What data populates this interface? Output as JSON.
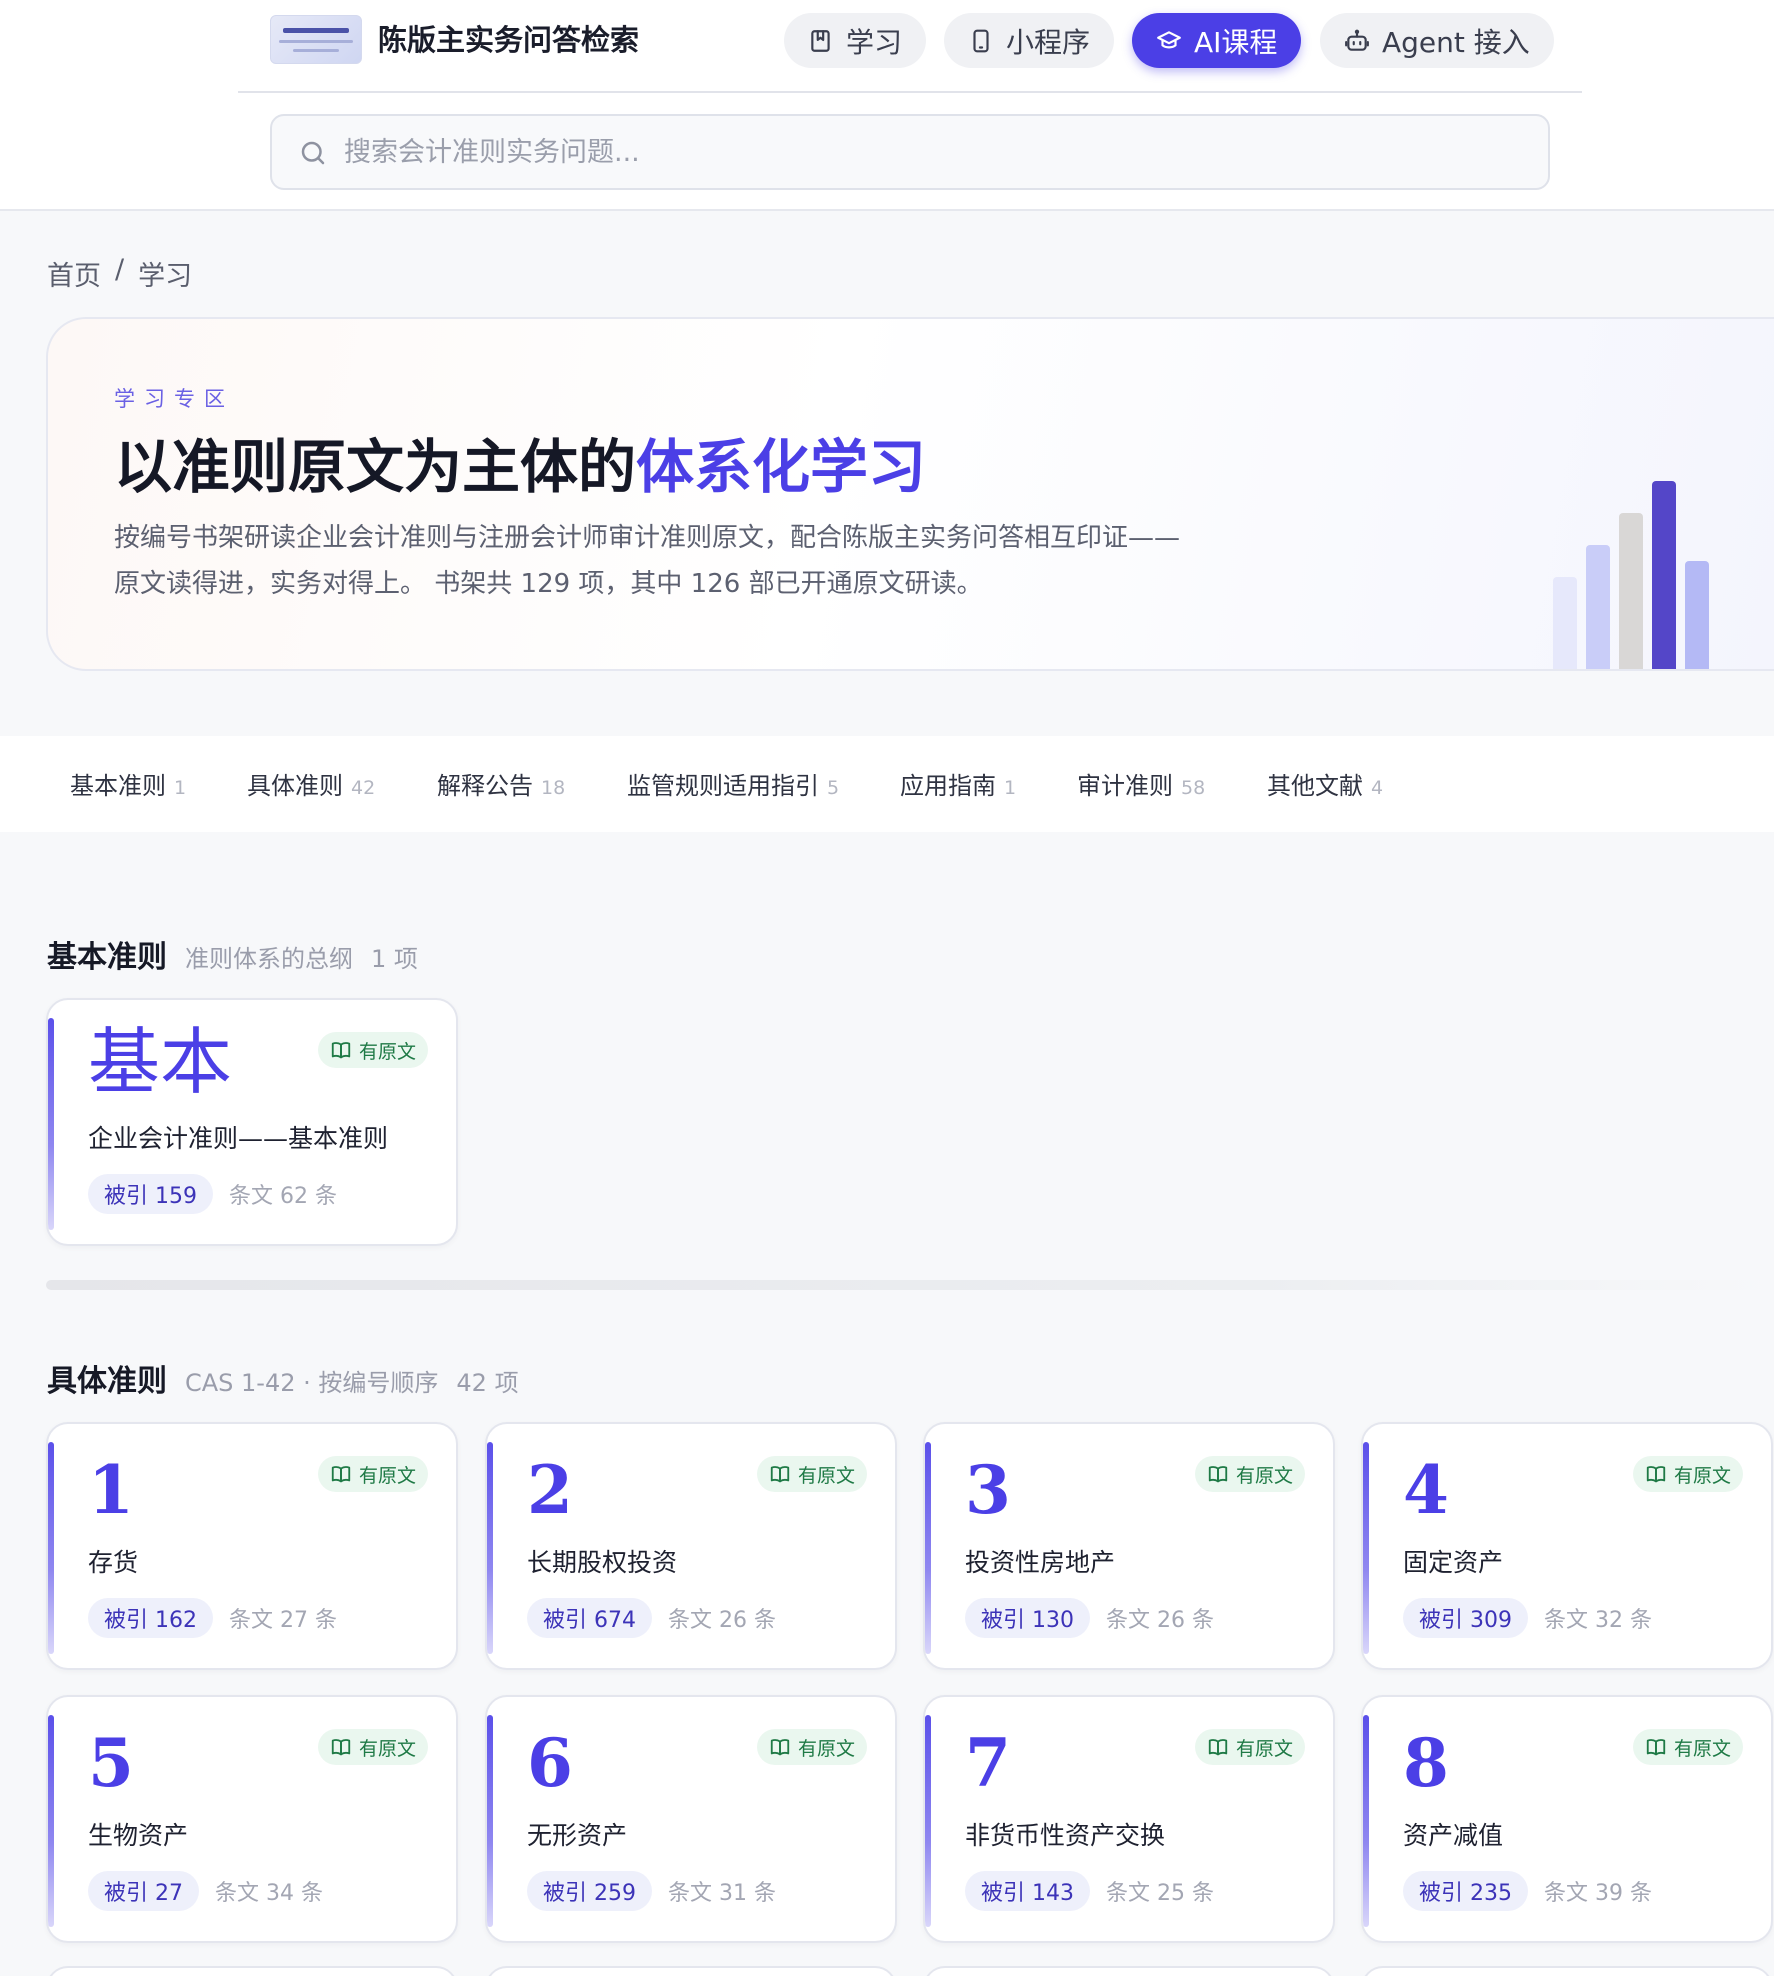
{
  "header": {
    "site_title": "陈版主实务问答检索",
    "nav": [
      {
        "label": "学习",
        "icon": "book-icon"
      },
      {
        "label": "小程序",
        "icon": "phone-icon"
      },
      {
        "label": "AI课程",
        "icon": "graduation-cap-icon"
      },
      {
        "label": "Agent 接入",
        "icon": "robot-icon"
      }
    ],
    "active_nav": "AI课程"
  },
  "search": {
    "placeholder": "搜索会计准则实务问题...",
    "value": ""
  },
  "breadcrumb": {
    "home": "首页",
    "separator": "/",
    "current": "学习"
  },
  "hero": {
    "kicker": "学习专区",
    "title_prefix": "以准则原文为主体的",
    "title_accent": "体系化学习",
    "desc_line1": "按编号书架研读企业会计准则与注册会计师审计准则原文，配合陈版主实务问答相互印证——",
    "desc_line2": "原文读得进，实务对得上。 书架共 129 项，其中 126 部已开通原文研读。"
  },
  "tabs": [
    {
      "label": "基本准则",
      "count": "1"
    },
    {
      "label": "具体准则",
      "count": "42"
    },
    {
      "label": "解释公告",
      "count": "18"
    },
    {
      "label": "监管规则适用指引",
      "count": "5"
    },
    {
      "label": "应用指南",
      "count": "1"
    },
    {
      "label": "审计准则",
      "count": "58"
    },
    {
      "label": "其他文献",
      "count": "4"
    }
  ],
  "sections": {
    "basic": {
      "heading": "基本准则",
      "subtitle": "准则体系的总纲",
      "count": "1 项",
      "cards": [
        {
          "num": "基本",
          "title": "企业会计准则——基本准则",
          "badge": "有原文",
          "cited": "被引 159",
          "articles": "条文 62 条"
        }
      ]
    },
    "specific": {
      "heading": "具体准则",
      "subtitle": "CAS 1-42 · 按编号顺序",
      "count": "42 项",
      "cards": [
        {
          "num": "1",
          "title": "存货",
          "badge": "有原文",
          "cited": "被引 162",
          "articles": "条文 27 条"
        },
        {
          "num": "2",
          "title": "长期股权投资",
          "badge": "有原文",
          "cited": "被引 674",
          "articles": "条文 26 条"
        },
        {
          "num": "3",
          "title": "投资性房地产",
          "badge": "有原文",
          "cited": "被引 130",
          "articles": "条文 26 条"
        },
        {
          "num": "4",
          "title": "固定资产",
          "badge": "有原文",
          "cited": "被引 309",
          "articles": "条文 32 条"
        },
        {
          "num": "5",
          "title": "生物资产",
          "badge": "有原文",
          "cited": "被引 27",
          "articles": "条文 34 条"
        },
        {
          "num": "6",
          "title": "无形资产",
          "badge": "有原文",
          "cited": "被引 259",
          "articles": "条文 31 条"
        },
        {
          "num": "7",
          "title": "非货币性资产交换",
          "badge": "有原文",
          "cited": "被引 143",
          "articles": "条文 25 条"
        },
        {
          "num": "8",
          "title": "资产减值",
          "badge": "有原文",
          "cited": "被引 235",
          "articles": "条文 39 条"
        }
      ]
    }
  },
  "colors": {
    "accent": "#4b3fe6",
    "badge_green": "#1f7a46",
    "badge_green_bg": "#eaf7ef"
  }
}
